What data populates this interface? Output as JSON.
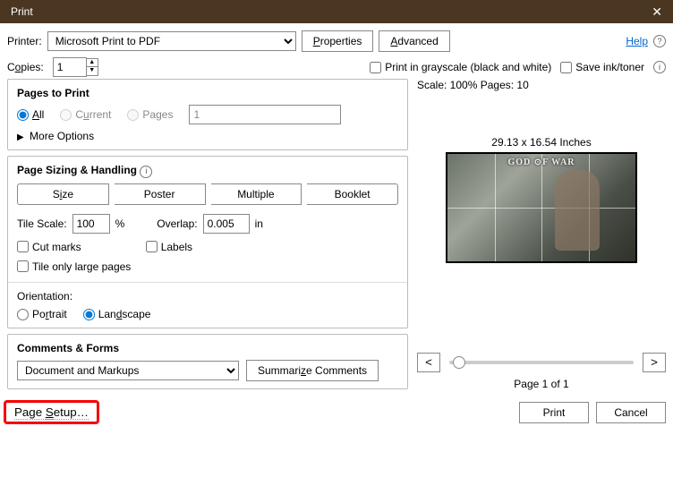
{
  "window": {
    "title": "Print"
  },
  "toolbar": {
    "printer_label": "Printer:",
    "printer_value": "Microsoft Print to PDF",
    "properties": "Properties",
    "advanced": "Advanced",
    "help": "Help",
    "copies_label": "Copies:",
    "copies_value": "1",
    "grayscale": "Print in grayscale (black and white)",
    "save_ink": "Save ink/toner"
  },
  "pages": {
    "title": "Pages to Print",
    "all": "All",
    "current": "Current",
    "pages": "Pages",
    "range_value": "1",
    "more": "More Options"
  },
  "sizing": {
    "title": "Page Sizing & Handling",
    "size": "Size",
    "poster": "Poster",
    "multiple": "Multiple",
    "booklet": "Booklet",
    "tile_scale_label": "Tile Scale:",
    "tile_scale_value": "100",
    "tile_scale_unit": "%",
    "overlap_label": "Overlap:",
    "overlap_value": "0.005",
    "overlap_unit": "in",
    "cut_marks": "Cut marks",
    "labels": "Labels",
    "tile_large": "Tile only large pages"
  },
  "orientation": {
    "title": "Orientation:",
    "portrait": "Portrait",
    "landscape": "Landscape"
  },
  "comments": {
    "title": "Comments & Forms",
    "value": "Document and Markups",
    "summarize": "Summarize Comments"
  },
  "preview": {
    "scale_pages": "Scale: 100% Pages: 10",
    "dimensions": "29.13 x 16.54 Inches",
    "logo": "GOD ⊙F WAR",
    "prev": "<",
    "next": ">",
    "page_of": "Page 1 of 1"
  },
  "footer": {
    "page_setup": "Page Setup…",
    "print": "Print",
    "cancel": "Cancel"
  }
}
